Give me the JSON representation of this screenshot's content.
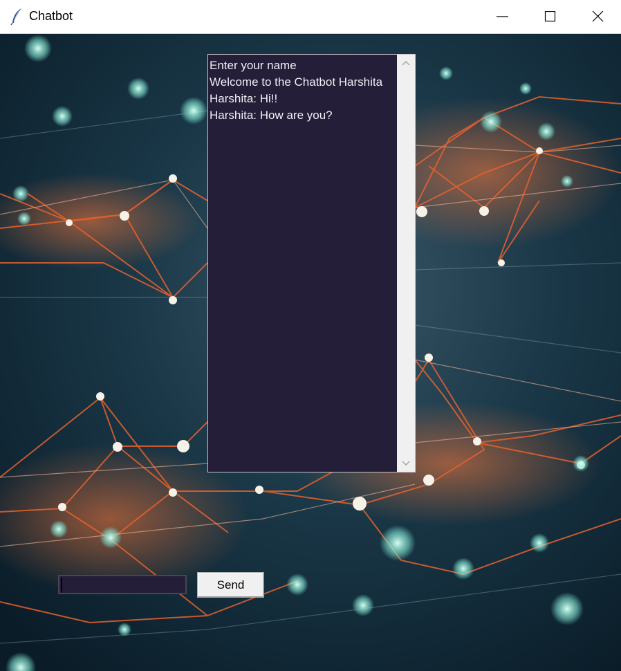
{
  "window": {
    "title": "Chatbot",
    "icon": "feather-icon",
    "controls": [
      "minimize-icon",
      "maximize-icon",
      "close-icon"
    ]
  },
  "chat": {
    "lines": [
      "Enter your name",
      "Welcome to the Chatbot Harshita",
      "Harshita: Hi!!",
      "Harshita: How are you?"
    ]
  },
  "input": {
    "value": ""
  },
  "send_button": {
    "label": "Send"
  },
  "colors": {
    "chat_background": "#241e38",
    "chat_text": "#f1eef5",
    "network_orange": "#e8612c",
    "network_nodes": "#bff5e8",
    "background_dark": "#0d2230"
  }
}
